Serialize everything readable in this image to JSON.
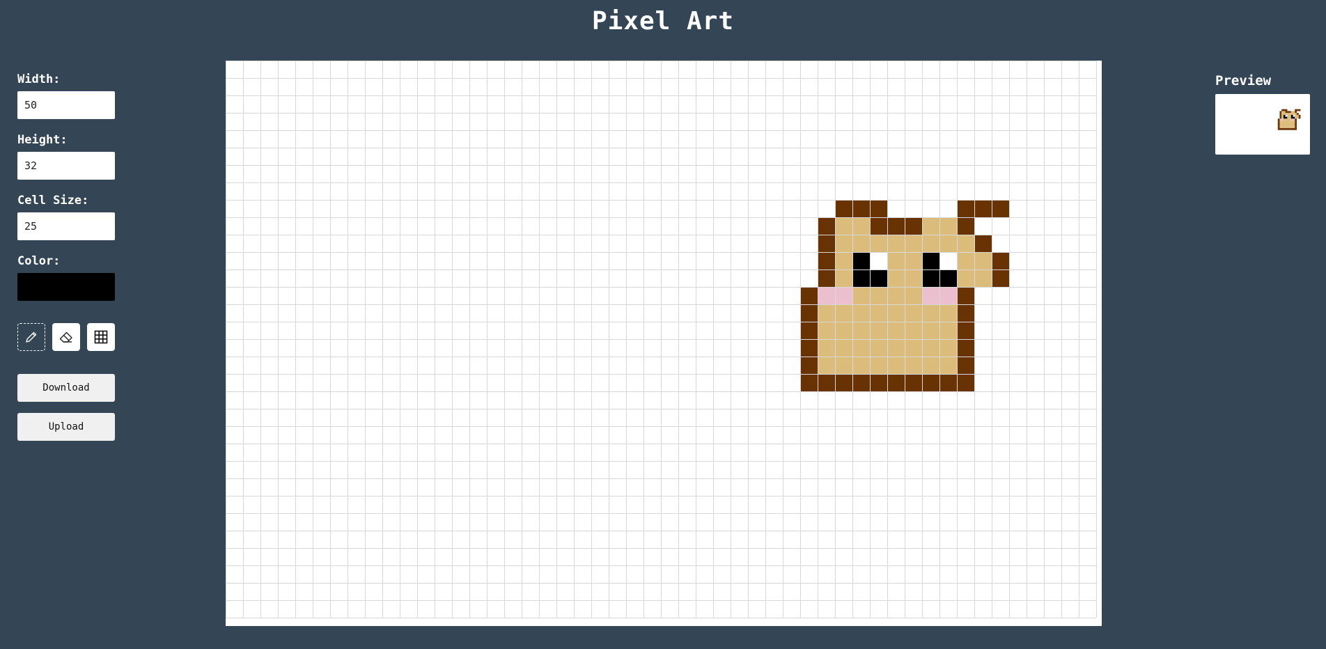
{
  "app": {
    "title": "Pixel Art"
  },
  "controls": {
    "width_label": "Width:",
    "width_value": "50",
    "height_label": "Height:",
    "height_value": "32",
    "cell_label": "Cell Size:",
    "cell_value": "25",
    "color_label": "Color:",
    "color_value": "#000000"
  },
  "tools": [
    {
      "name": "pencil-icon",
      "active": true
    },
    {
      "name": "eraser-icon",
      "active": false
    },
    {
      "name": "grid-icon",
      "active": false
    }
  ],
  "actions": {
    "download_label": "Download",
    "upload_label": "Upload"
  },
  "preview": {
    "label": "Preview"
  },
  "grid": {
    "columns": 50,
    "rows": 32,
    "line_color": "#d8d8d8",
    "palette": {
      "D": "#683203",
      "T": "#dcbc7b",
      "K": "#000000",
      "W": "#ffffff",
      "P": "#ecbfcf",
      "G": "#009a0b",
      "L": "#94bb0f"
    },
    "art": [
      "..................................................",
      "..................................................",
      "..................................................",
      "..................................................",
      "..................................................",
      "..................................................",
      "..................................................",
      "..................................................",
      "...................................DDD....DDD.....",
      "..................................DTTDDDTTD.......",
      "..................................DTTTTTTTTD......",
      "..................................DTKWTTKWTTD.....",
      "..................................DTKKTTKKTTD.....",
      ".................................DPPTTTTPPD.......",
      ".................................DTTTTTTTTD.......",
      ".................................DTTTTTTTTD.......",
      ".................................DTTTTTTTTD.......",
      ".................................DTTTTTTTTD.......",
      ".................................DDDDDDDDDD.......",
      "..................................................",
      "..................................................",
      "..................................................",
      "..................................................",
      "..................................................",
      "..................................................",
      "..................................................",
      "..................................................",
      "..................................................",
      "..................................................",
      "..................................................",
      "..................................................",
      ".................................................."
    ]
  }
}
